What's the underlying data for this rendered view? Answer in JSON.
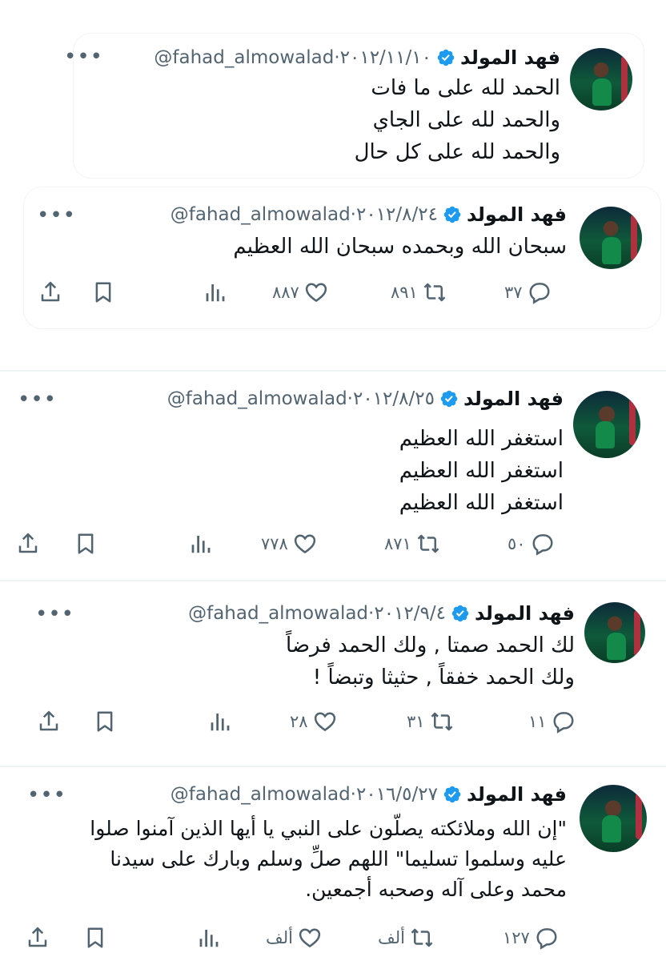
{
  "user": {
    "name": "فهد المولد",
    "handle": "@fahad_almowalad"
  },
  "colors": {
    "text": "#0f1419",
    "secondary": "#536471",
    "verified": "#1d9bf0"
  },
  "tweets": [
    {
      "date": "٢٠١٢/١١/١٠",
      "text": "الحمد لله على ما فات\nوالحمد لله على الجاي\nوالحمد لله على كل حال"
    },
    {
      "date": "٢٠١٢/٨/٢٤",
      "text": "سبحان الله وبحمده سبحان الله العظيم",
      "replies": "٣٧",
      "retweets": "٨٩١",
      "likes": "٨٨٧"
    },
    {
      "date": "٢٠١٢/٨/٢٥",
      "text": "استغفر الله العظيم\nاستغفر الله العظيم\nاستغفر الله العظيم",
      "replies": "٥٠",
      "retweets": "٨٧١",
      "likes": "٧٧٨"
    },
    {
      "date": "٢٠١٢/٩/٤",
      "text": "لك الحمد صمتا , ولك الحمد فرضاً\nولك الحمد خفقاً , حثيثا وتبضاً !",
      "replies": "١١",
      "retweets": "٣١",
      "likes": "٢٨"
    },
    {
      "date": "٢٠١٦/٥/٢٧",
      "text": "\"إن الله وملائكته يصلّون على النبي يا أيها الذين آمنوا صلوا\nعليه وسلموا تسليما\" اللهم صلِّ وسلم وبارك على سيدنا\nمحمد وعلى آله وصحبه أجمعين.",
      "replies": "١٢٧",
      "retweets": "ألف",
      "likes": "ألف"
    }
  ],
  "icons": [
    "verified-badge-icon",
    "more-icon",
    "reply-icon",
    "retweet-icon",
    "like-icon",
    "views-icon",
    "bookmark-icon",
    "share-icon"
  ]
}
